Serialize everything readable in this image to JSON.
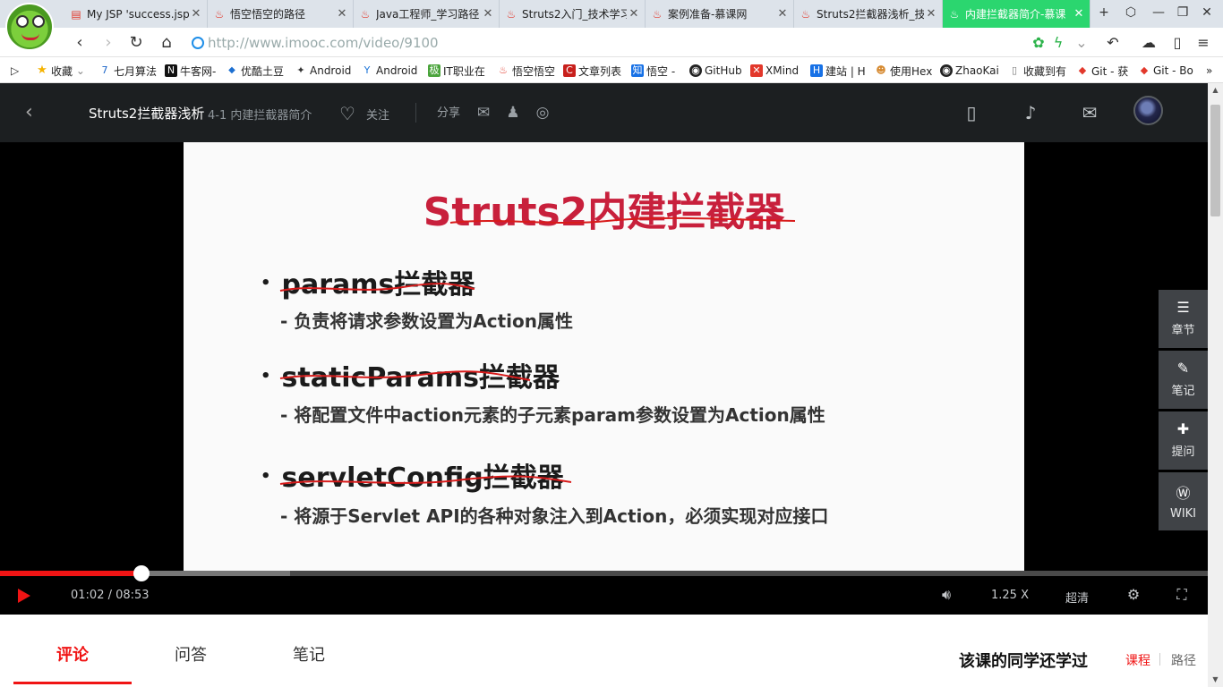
{
  "browser": {
    "tabs": [
      {
        "title": "My JSP 'success.jsp'",
        "icon": "page-icon"
      },
      {
        "title": "悟空悟空的路径",
        "icon": "imooc-flame-icon"
      },
      {
        "title": "Java工程师_学习路径",
        "icon": "imooc-flame-icon"
      },
      {
        "title": "Struts2入门_技术学习",
        "icon": "imooc-flame-icon"
      },
      {
        "title": "案例准备-慕课网",
        "icon": "imooc-flame-icon"
      },
      {
        "title": "Struts2拦截器浅析_技",
        "icon": "imooc-flame-icon"
      },
      {
        "title": "内建拦截器简介-慕课",
        "icon": "imooc-flame-icon",
        "active": true
      }
    ],
    "address": "http://www.imooc.com/video/9100",
    "bookmarks": [
      {
        "label": "收藏",
        "icon": "star-icon",
        "color": "#f5b301"
      },
      {
        "label": "七月算法",
        "icon": "seven-icon",
        "color": "#1a64c8"
      },
      {
        "label": "牛客网-",
        "icon": "nowcoder-icon",
        "color": "#111111"
      },
      {
        "label": "优酷土豆",
        "icon": "youku-icon",
        "color": "#1c6fd1"
      },
      {
        "label": "Android",
        "icon": "android-icon",
        "color": "#333333"
      },
      {
        "label": "Android",
        "icon": "android-icon",
        "color": "#1c74d8"
      },
      {
        "label": "IT职业在",
        "icon": "it-icon",
        "color": "#4aa43b"
      },
      {
        "label": "悟空悟空",
        "icon": "imooc-flame-icon",
        "color": "#e2382b"
      },
      {
        "label": "文章列表",
        "icon": "csdn-icon",
        "color": "#c8201c"
      },
      {
        "label": "悟空 -",
        "icon": "zhihu-icon",
        "color": "#1771e6"
      },
      {
        "label": "GitHub",
        "icon": "github-icon",
        "color": "#222222"
      },
      {
        "label": "XMind",
        "icon": "xmind-icon",
        "color": "#e2382b"
      },
      {
        "label": "建站 | H",
        "icon": "hexo-icon",
        "color": "#1771e6"
      },
      {
        "label": "使用Hex",
        "icon": "person-icon",
        "color": "#d68a31"
      },
      {
        "label": "ZhaoKai",
        "icon": "github-icon",
        "color": "#222222"
      },
      {
        "label": "收藏到有",
        "icon": "page-icon",
        "color": "#777777"
      },
      {
        "label": "Git - 获",
        "icon": "git-icon",
        "color": "#e2382b"
      },
      {
        "label": "Git - Bo",
        "icon": "git-icon",
        "color": "#e2382b"
      }
    ]
  },
  "header": {
    "course": "Struts2拦截器浅析",
    "chapter": "4-1 内建拦截器简介",
    "follow": "关注",
    "share": "分享"
  },
  "slide": {
    "title": "Struts2内建拦截器",
    "items": [
      {
        "name": "params拦截器",
        "desc": "- 负责将请求参数设置为Action属性"
      },
      {
        "name": "staticParams拦截器",
        "desc": "- 将配置文件中action元素的子元素param参数设置为Action属性"
      },
      {
        "name": "servletConfig拦截器",
        "desc": "- 将源于Servlet API的各种对象注入到Action，必须实现对应接口"
      }
    ]
  },
  "side_tools": [
    "章节",
    "笔记",
    "提问",
    "WIKI"
  ],
  "player": {
    "time": "01:02 / 08:53",
    "progress_fraction": 0.117,
    "buffered_fraction": 0.24,
    "speed": "1.25 X",
    "quality": "超清"
  },
  "bottom_tabs": [
    "评论",
    "问答",
    "笔记"
  ],
  "also_learned": {
    "title": "该课的同学还学过",
    "tabs": [
      "课程",
      "路径"
    ]
  },
  "colors": {
    "accent": "#f01414",
    "active_tab": "#2bd66f",
    "slide_title": "#c8203c"
  }
}
